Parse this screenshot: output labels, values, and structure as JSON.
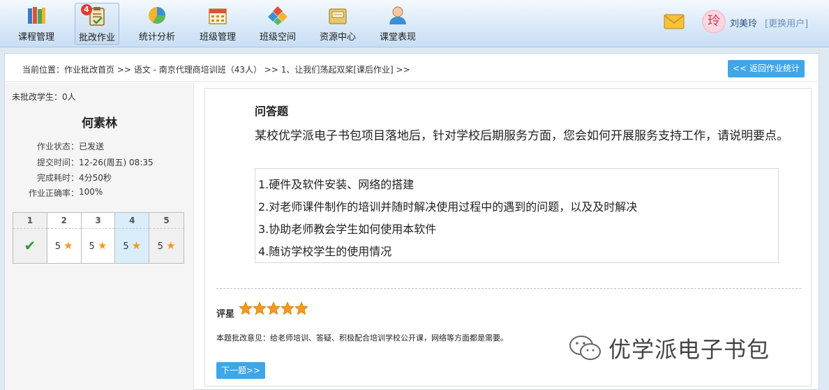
{
  "nav": {
    "items": [
      {
        "label": "课程管理",
        "icon": "books-icon"
      },
      {
        "label": "批改作业",
        "icon": "clipboard-check-icon",
        "badge": "4",
        "active": true
      },
      {
        "label": "统计分析",
        "icon": "pie-chart-icon"
      },
      {
        "label": "班级管理",
        "icon": "calendar-icon"
      },
      {
        "label": "班级空间",
        "icon": "blocks-icon"
      },
      {
        "label": "资源中心",
        "icon": "folder-icon"
      },
      {
        "label": "课堂表现",
        "icon": "person-icon"
      }
    ]
  },
  "user": {
    "avatar_char": "玲",
    "name": "刘美玲",
    "switch_label": "[更换用户]"
  },
  "breadcrumb": "当前位置：作业批改首页 >> 语文 - 南京代理商培训班（43人） >> 1、让我们荡起双桨[课后作业] >>",
  "back_button": "<< 返回作业统计",
  "left": {
    "ungraded": "未批改学生：0人",
    "student_name": "何素林",
    "info": [
      {
        "key": "作业状态：",
        "value": "已发送"
      },
      {
        "key": "提交时间：",
        "value": "12-26(周五) 08:35"
      },
      {
        "key": "完成耗时：",
        "value": "4分50秒"
      },
      {
        "key": "作业正确率：",
        "value": "100%"
      }
    ],
    "questions": [
      {
        "num": "1",
        "result": "correct"
      },
      {
        "num": "2",
        "score": "5"
      },
      {
        "num": "3",
        "score": "5"
      },
      {
        "num": "4",
        "score": "5",
        "current": true
      },
      {
        "num": "5",
        "score": "5"
      }
    ]
  },
  "question": {
    "type": "问答题",
    "text": "某校优学派电子书包项目落地后，针对学校后期服务方面，您会如何开展服务支持工作，请说明要点。",
    "answers": [
      "1.硬件及软件安装、网络的搭建",
      "2.对老师课件制作的培训并随时解决使用过程中的遇到的问题，以及及时解决",
      "3.协助老师教会学生如何使用本软件",
      "4.随访学校学生的使用情况"
    ]
  },
  "rating": {
    "label": "评星",
    "stars": 5,
    "star_color": "#f29a1b"
  },
  "comment": "本题批改意见：给老师培训、答疑、积极配合培训学校公开课，网络等方面都是需要。",
  "next_button": "下一题>>",
  "watermark": "优学派电子书包"
}
